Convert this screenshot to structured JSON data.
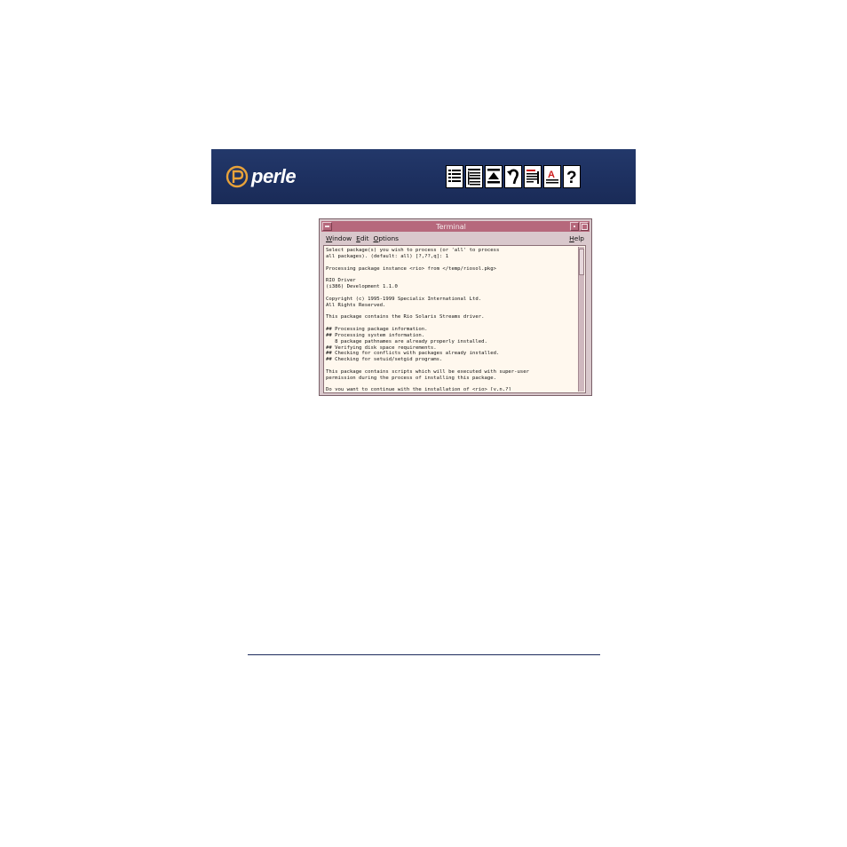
{
  "banner": {
    "brand": "perle",
    "nav_icons": [
      "contents-icon",
      "index-icon",
      "top-icon",
      "back-icon",
      "glossary-icon",
      "text-icon",
      "help-icon"
    ],
    "colors": {
      "background": "#1d3060",
      "logo": "#e8a23a"
    }
  },
  "window": {
    "title": "Terminal",
    "menu": [
      "Window",
      "Edit",
      "Options"
    ],
    "menu_mnemonics": [
      "W",
      "E",
      "O"
    ],
    "help": "Help",
    "lines": [
      "Select package(s) you wish to process (or 'all' to process",
      "all packages). (default: all) [?,??,q]: 1",
      "",
      "Processing package instance <rio> from </temp/riosol.pkg>",
      "",
      "RIO Driver",
      "(i386) Development 1.1.0",
      "",
      "Copyright (c) 1995-1999 Specialix International Ltd.",
      "All Rights Reserved.",
      "",
      "This package contains the Rio Solaris Streams driver.",
      "",
      "## Processing package information.",
      "## Processing system information.",
      "   8 package pathnames are already properly installed.",
      "## Verifying disk space requirements.",
      "## Checking for conflicts with packages already installed.",
      "## Checking for setuid/setgid programs.",
      "",
      "This package contains scripts which will be executed with super-user",
      "permission during the process of installing this package.",
      "",
      "Do you want to continue with the installation of <rio> [y,n,?]"
    ],
    "colors": {
      "titlebar": "#b6687c",
      "frame": "#d9c8cc",
      "terminal_bg": "#fff8ee"
    }
  }
}
